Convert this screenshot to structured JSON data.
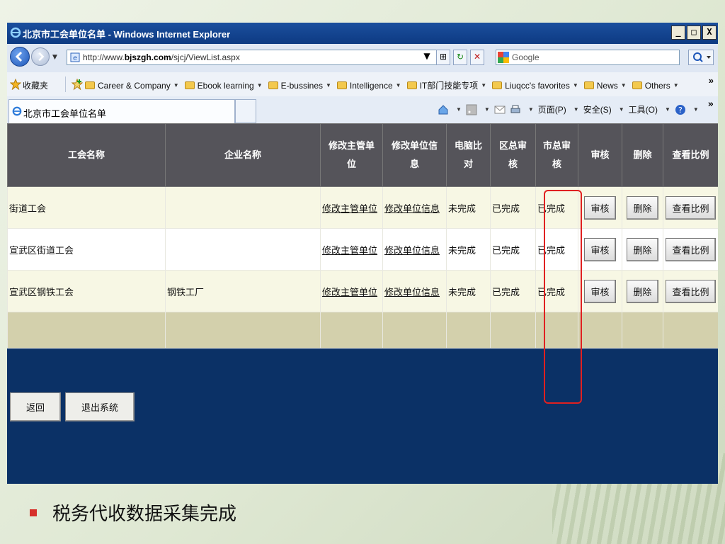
{
  "window": {
    "title": "北京市工会单位名单 - Windows Internet Explorer",
    "controls": [
      "_",
      "□",
      "X"
    ]
  },
  "address_bar": {
    "url_prefix": "http://www.",
    "url_domain": "bjszgh.com",
    "url_path": "/sjcj/ViewList.aspx",
    "search_placeholder": "Google"
  },
  "favorites_bar": {
    "label": "收藏夹",
    "items": [
      {
        "label": "Career & Company"
      },
      {
        "label": "Ebook learning"
      },
      {
        "label": "E-bussines"
      },
      {
        "label": "Intelligence"
      },
      {
        "label": "IT部门技能专项"
      },
      {
        "label": "Liuqcc's favorites"
      },
      {
        "label": "News"
      },
      {
        "label": "Others"
      }
    ],
    "more": "»"
  },
  "tab_bar": {
    "active_tab": "北京市工会单位名单",
    "commands": {
      "page": "页面(P)",
      "safety": "安全(S)",
      "tools": "工具(O)"
    },
    "more": "»"
  },
  "table": {
    "headers": [
      [
        "工会名称"
      ],
      [
        "企业名称"
      ],
      [
        "修改主管单",
        "位"
      ],
      [
        "修改单位信",
        "息"
      ],
      [
        "电脑比",
        "对"
      ],
      [
        "区总审",
        "核"
      ],
      [
        "市总审",
        "核"
      ],
      [
        "审核"
      ],
      [
        "删除"
      ],
      [
        "查看比例"
      ]
    ],
    "rows": [
      {
        "union": "街道工会",
        "company": "",
        "edit_dept": "修改主管单位",
        "edit_info": "修改单位信息",
        "computer_compare": "未完成",
        "district_review": "已完成",
        "city_review": "已完成",
        "review_btn": "审核",
        "delete_btn": "删除",
        "ratio_btn": "查看比例"
      },
      {
        "union": "宣武区街道工会",
        "company": "",
        "edit_dept": "修改主管单位",
        "edit_info": "修改单位信息",
        "computer_compare": "未完成",
        "district_review": "已完成",
        "city_review": "已完成",
        "review_btn": "审核",
        "delete_btn": "删除",
        "ratio_btn": "查看比例"
      },
      {
        "union": "宣武区钢铁工会",
        "company": "钢铁工厂",
        "edit_dept": "修改主管单位",
        "edit_info": "修改单位信息",
        "computer_compare": "未完成",
        "district_review": "已完成",
        "city_review": "已完成",
        "review_btn": "审核",
        "delete_btn": "删除",
        "ratio_btn": "查看比例"
      }
    ]
  },
  "footer_buttons": {
    "back": "返回",
    "exit": "退出系统"
  },
  "slide": {
    "bullet_text": "税务代收数据采集完成",
    "bullet_color": "#d6302a"
  },
  "colors": {
    "header_bg": "#55545a",
    "page_bg": "#0b3166",
    "highlight": "#e02020"
  }
}
